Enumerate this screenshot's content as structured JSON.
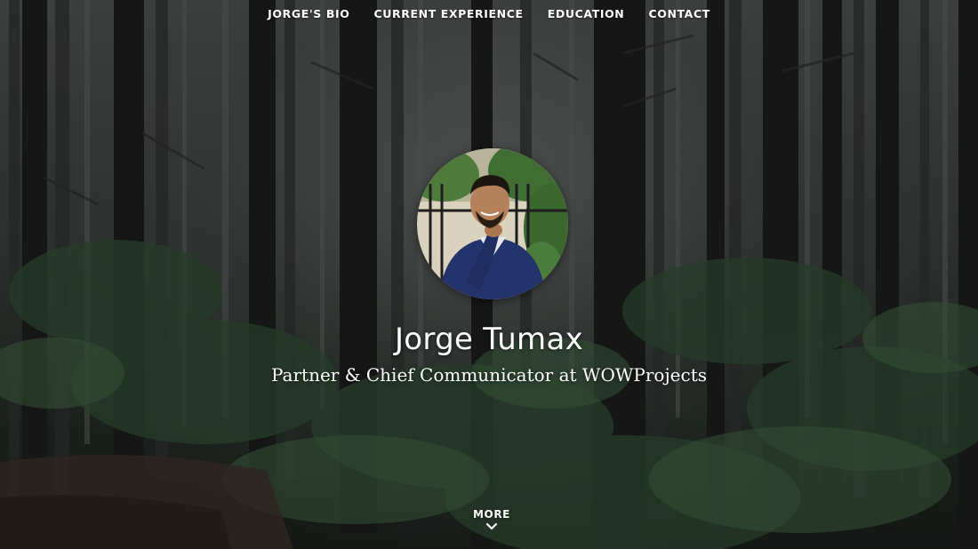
{
  "nav": {
    "items": [
      {
        "label": "JORGE'S BIO"
      },
      {
        "label": "CURRENT EXPERIENCE"
      },
      {
        "label": "EDUCATION"
      },
      {
        "label": "CONTACT"
      }
    ]
  },
  "hero": {
    "name": "Jorge Tumax",
    "tagline": "Partner & Chief Communicator at WOWProjects",
    "background_description_icon": "forest-background",
    "more_label": "MORE",
    "more_icon": "chevron-down-icon"
  },
  "colors": {
    "text": "#ffffff",
    "forest_dark": "#1a1d1a",
    "fog": "#4a4d4c",
    "shirt": "#23336b"
  }
}
